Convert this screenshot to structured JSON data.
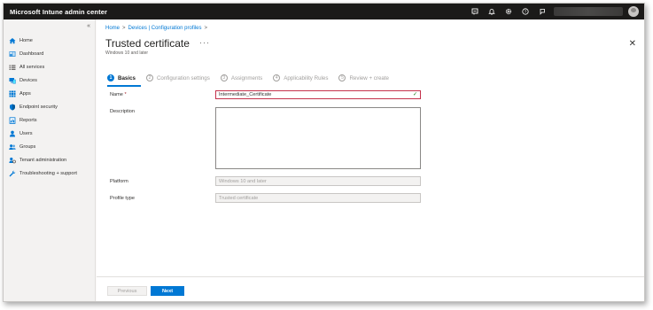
{
  "app": {
    "title": "Microsoft Intune admin center"
  },
  "topbar": {
    "icons": [
      "feedback-icon",
      "bell-icon",
      "gear-icon",
      "help-icon",
      "person-feedback-icon"
    ]
  },
  "sidebar": {
    "collapse": "«",
    "items": [
      {
        "label": "Home",
        "icon": "home-icon"
      },
      {
        "label": "Dashboard",
        "icon": "dashboard-icon"
      },
      {
        "label": "All services",
        "icon": "all-services-icon"
      },
      {
        "label": "Devices",
        "icon": "devices-icon"
      },
      {
        "label": "Apps",
        "icon": "apps-icon"
      },
      {
        "label": "Endpoint security",
        "icon": "endpoint-security-icon"
      },
      {
        "label": "Reports",
        "icon": "reports-icon"
      },
      {
        "label": "Users",
        "icon": "users-icon"
      },
      {
        "label": "Groups",
        "icon": "groups-icon"
      },
      {
        "label": "Tenant administration",
        "icon": "tenant-admin-icon"
      },
      {
        "label": "Troubleshooting + support",
        "icon": "troubleshooting-icon"
      }
    ]
  },
  "breadcrumb": {
    "home": "Home",
    "devices": "Devices | Configuration profiles",
    "sep": ">"
  },
  "page": {
    "title": "Trusted certificate",
    "more": "···",
    "subtitle": "Windows 10 and later",
    "close": "✕"
  },
  "steps": [
    {
      "num": "1",
      "label": "Basics",
      "active": true
    },
    {
      "num": "2",
      "label": "Configuration settings"
    },
    {
      "num": "3",
      "label": "Assignments"
    },
    {
      "num": "4",
      "label": "Applicability Rules"
    },
    {
      "num": "5",
      "label": "Review + create"
    }
  ],
  "form": {
    "name_label": "Name",
    "required_mark": "*",
    "name_value": "Intermediate_Certificate",
    "description_label": "Description",
    "description_value": "",
    "platform_label": "Platform",
    "platform_value": "Windows 10 and later",
    "profile_type_label": "Profile type",
    "profile_type_value": "Trusted certificate"
  },
  "footer": {
    "previous": "Previous",
    "next": "Next"
  },
  "colors": {
    "accent": "#0078d4",
    "topbar": "#1b1a19",
    "invalid": "#c4314b",
    "valid": "#107c10"
  }
}
